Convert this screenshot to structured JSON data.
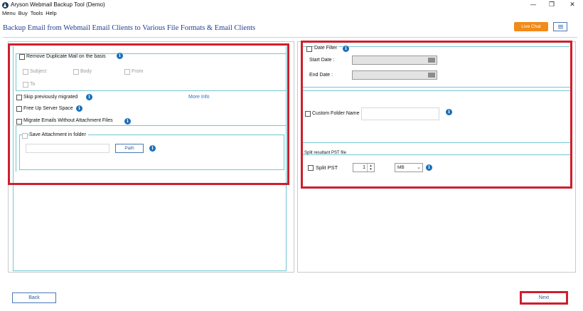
{
  "window": {
    "title": "Aryson Webmail Backup Tool (Demo)",
    "controls": {
      "minimize": "—",
      "maximize": "❐",
      "close": "✕"
    }
  },
  "menubar": {
    "items": [
      "Menu",
      "Buy",
      "Tools",
      "Help"
    ]
  },
  "header": {
    "title": "Backup Email from Webmail Email Clients to Various File Formats & Email Clients",
    "live_chat": "Live Chat"
  },
  "left": {
    "remove_duplicate": {
      "label": "Remove Duplicate Mail on the basis",
      "options": [
        "Subject",
        "Body",
        "From",
        "To"
      ]
    },
    "skip_migrated": "Skip previously migrated",
    "more_info": "More Info",
    "free_up": "Free Up Server Space",
    "migrate_without_attachments": "Migrate Emails Without Attachment Files",
    "save_attachment": "Save Attachment in folder",
    "path_button": "Path"
  },
  "right": {
    "date_filter": "Date Filter",
    "start_date": "Start Date :",
    "end_date": "End Date :",
    "custom_folder": "Custom Folder Name",
    "split_section": "Split resultant PST file",
    "split_pst": "Split PST",
    "split_value": "1",
    "split_unit": "MB"
  },
  "footer": {
    "back": "Back",
    "next": "Next"
  },
  "colors": {
    "accent": "#1c6fb8",
    "live_chat": "#f28a1a",
    "highlight": "#cf1f2d",
    "border_teal": "#74c6d1"
  }
}
